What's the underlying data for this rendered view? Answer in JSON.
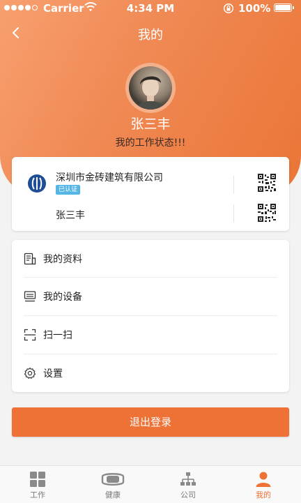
{
  "status_bar": {
    "carrier": "Carrier",
    "time": "4:34 PM",
    "battery": "100%"
  },
  "nav": {
    "title": "我的",
    "back_icon": "chevron-left-icon"
  },
  "profile": {
    "name": "张三丰",
    "status": "我的工作状态!!!"
  },
  "company_card": {
    "company_name": "深圳市金砖建筑有限公司",
    "verified_label": "已认证",
    "person_name": "张三丰"
  },
  "menu": {
    "items": [
      {
        "label": "我的资料",
        "icon": "profile-document-icon"
      },
      {
        "label": "我的设备",
        "icon": "device-icon"
      },
      {
        "label": "扫一扫",
        "icon": "scan-icon"
      },
      {
        "label": "设置",
        "icon": "gear-icon"
      }
    ]
  },
  "logout_label": "退出登录",
  "tabbar": {
    "tabs": [
      {
        "label": "工作",
        "icon": "grid-icon"
      },
      {
        "label": "健康",
        "icon": "health-band-icon"
      },
      {
        "label": "公司",
        "icon": "org-chart-icon"
      },
      {
        "label": "我的",
        "icon": "person-icon"
      }
    ],
    "active_index": 3
  },
  "colors": {
    "accent": "#ee7135",
    "hero_gradient_start": "#f8a070",
    "hero_gradient_end": "#ea7535",
    "verified_badge": "#55b6e6",
    "tab_inactive": "#7a7a7a"
  }
}
